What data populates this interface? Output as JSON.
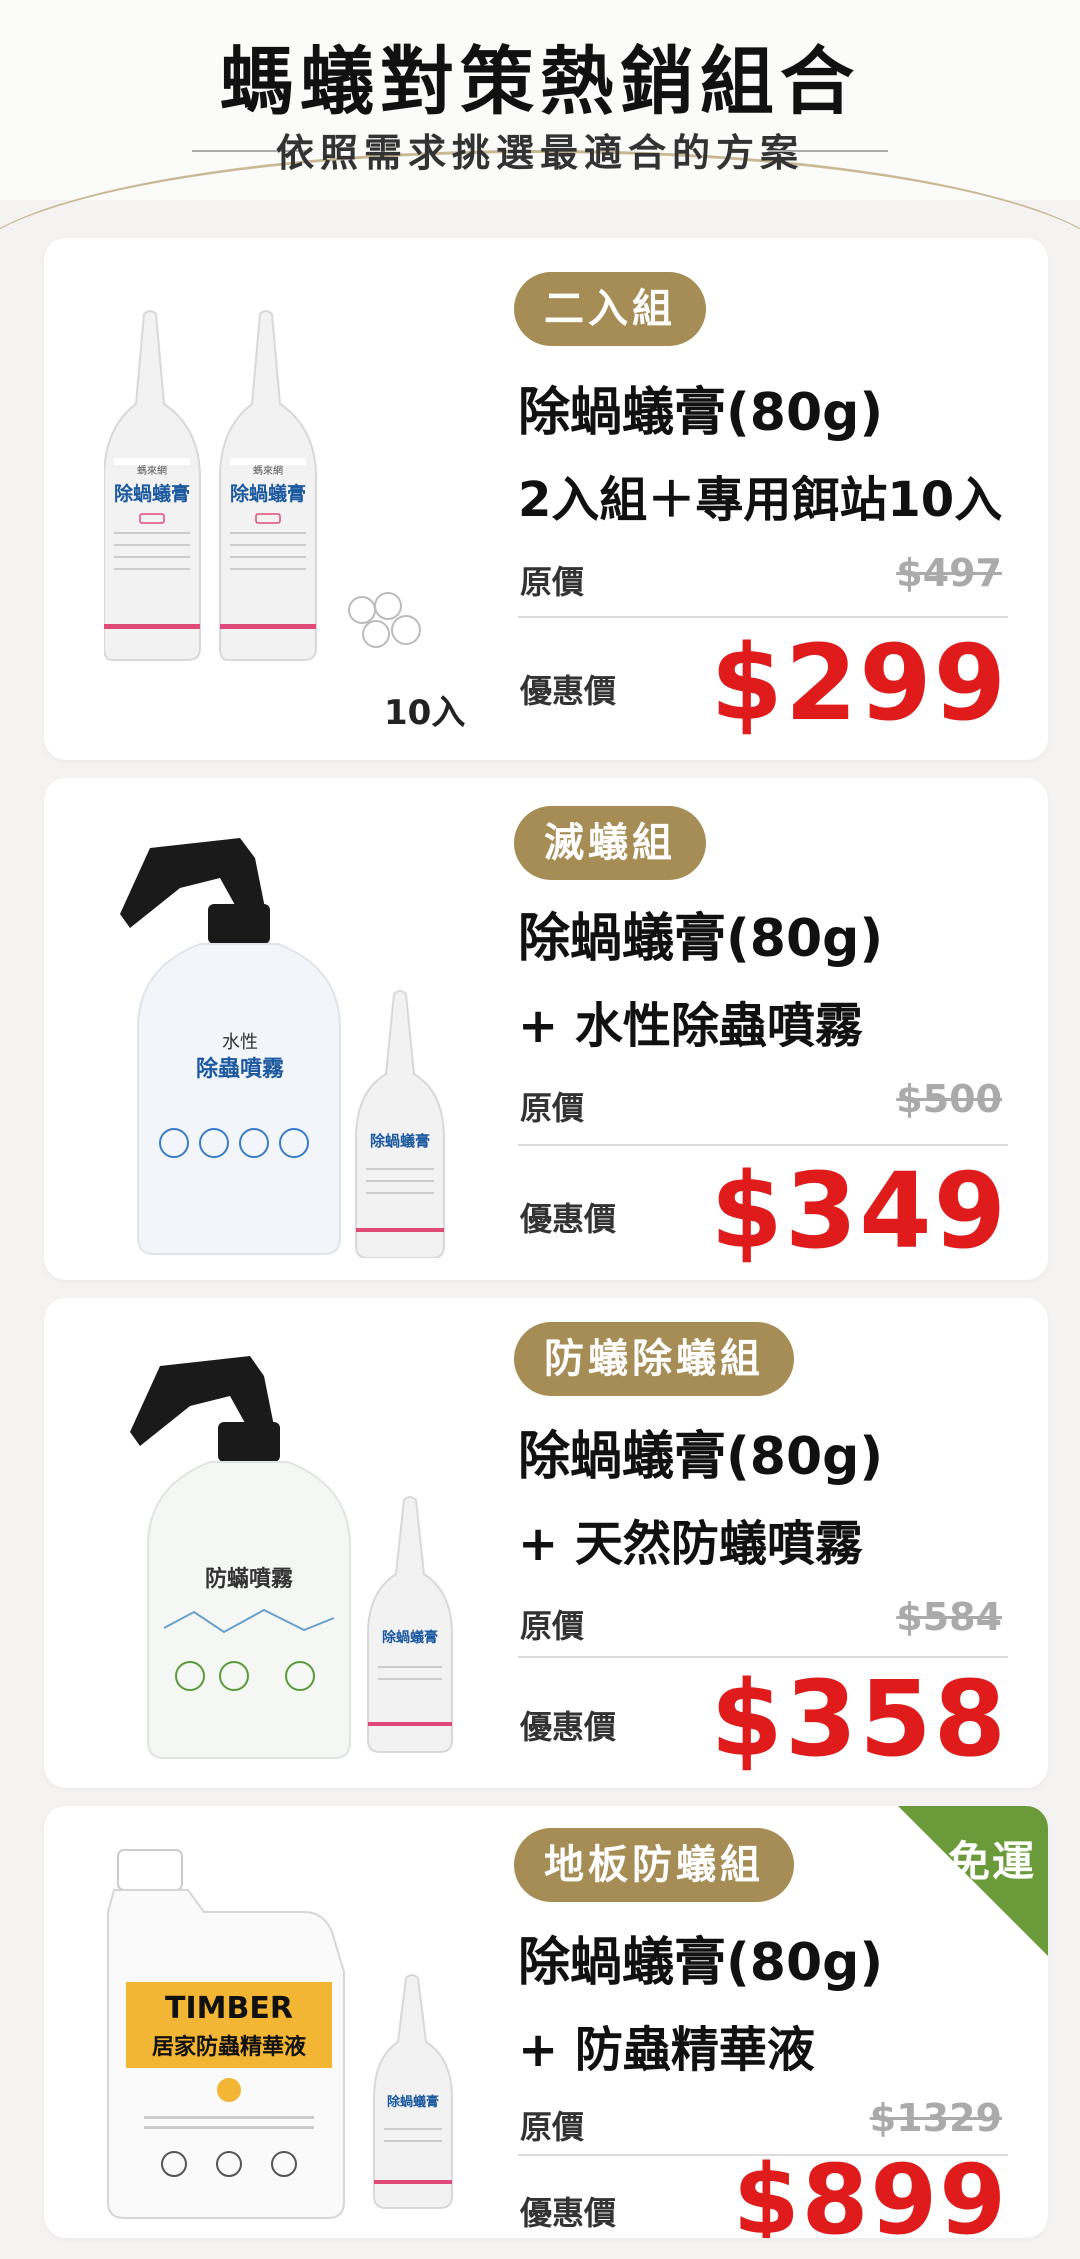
{
  "header": {
    "title": "螞蟻對策熱銷組合",
    "subtitle": "依照需求挑選最適合的方案"
  },
  "labels": {
    "original": "原價",
    "sale": "優惠價"
  },
  "colors": {
    "tag_bg": "#a68d55",
    "sale_red": "#e01b1b",
    "ship_green": "#6b9a3a"
  },
  "cards": [
    {
      "tag": "二入組",
      "name_line1": "除蝸蟻膏(80g)",
      "name_line2": "2入組＋專用餌站10入",
      "original_price": "$497",
      "sale_price": "$299",
      "product_label": "除蝸蟻膏",
      "extra_count": "10入"
    },
    {
      "tag": "滅蟻組",
      "name_line1": "除蝸蟻膏(80g)",
      "name_line2": "+ 水性除蟲噴霧",
      "original_price": "$500",
      "sale_price": "$349",
      "product_label": "除蝸蟻膏",
      "spray_label": "水性\n除蟲噴霧"
    },
    {
      "tag": "防蟻除蟻組",
      "name_line1": "除蝸蟻膏(80g)",
      "name_line2": "+ 天然防蟻噴霧",
      "original_price": "$584",
      "sale_price": "$358",
      "product_label": "除蝸蟻膏",
      "spray_label": "防蟎噴霧"
    },
    {
      "tag": "地板防蟻組",
      "name_line1": "除蝸蟻膏(80g)",
      "name_line2": "+ 防蟲精華液",
      "original_price": "$1329",
      "sale_price": "$899",
      "product_label": "除蝸蟻膏",
      "jug_brand": "TIMBER",
      "jug_label": "居家防蟲精華液",
      "badge": "免運"
    }
  ]
}
